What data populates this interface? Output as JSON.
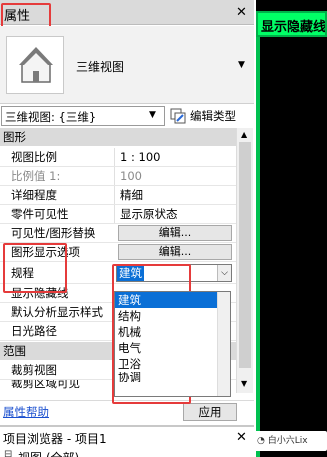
{
  "palette": {
    "title": "属性",
    "close": "✕",
    "type_selector": {
      "name": "三维视图",
      "icon": "house-icon"
    },
    "instance_selector": "三维视图: {三维}",
    "edit_type": "编辑类型"
  },
  "sections": {
    "graphics": "图形",
    "range": "范围"
  },
  "properties": [
    {
      "name": "视图比例",
      "value": "1 : 100"
    },
    {
      "name": "比例值 1:",
      "value": "100"
    },
    {
      "name": "详细程度",
      "value": "精细"
    },
    {
      "name": "零件可见性",
      "value": "显示原状态"
    },
    {
      "name": "可见性/图形替换",
      "value": "编辑..."
    },
    {
      "name": "图形显示选项",
      "value": "编辑..."
    },
    {
      "name": "规程",
      "value": "建筑"
    },
    {
      "name": "显示隐藏线",
      "value": ""
    },
    {
      "name": "默认分析显示样式",
      "value": ""
    },
    {
      "name": "日光路径",
      "value": ""
    }
  ],
  "range_properties": [
    {
      "name": "裁剪视图"
    },
    {
      "name": "裁剪区域可见"
    }
  ],
  "discipline_dropdown": {
    "options": [
      "建筑",
      "结构",
      "机械",
      "电气",
      "卫浴",
      "协调"
    ],
    "selected": "建筑"
  },
  "bottom": {
    "help": "属性帮助",
    "apply": "应用"
  },
  "browser": {
    "title": "项目浏览器 - 项目1",
    "close": "✕",
    "first_item": "视图 (全部)"
  },
  "viewport": {
    "title": "显示隐藏线"
  },
  "watermark": "白小六Lix",
  "colors": {
    "highlight_red": "#e53b3b",
    "selection_blue": "#0a6fd6",
    "viewport_green": "#00ff66",
    "help_link": "#1a4fcf"
  }
}
